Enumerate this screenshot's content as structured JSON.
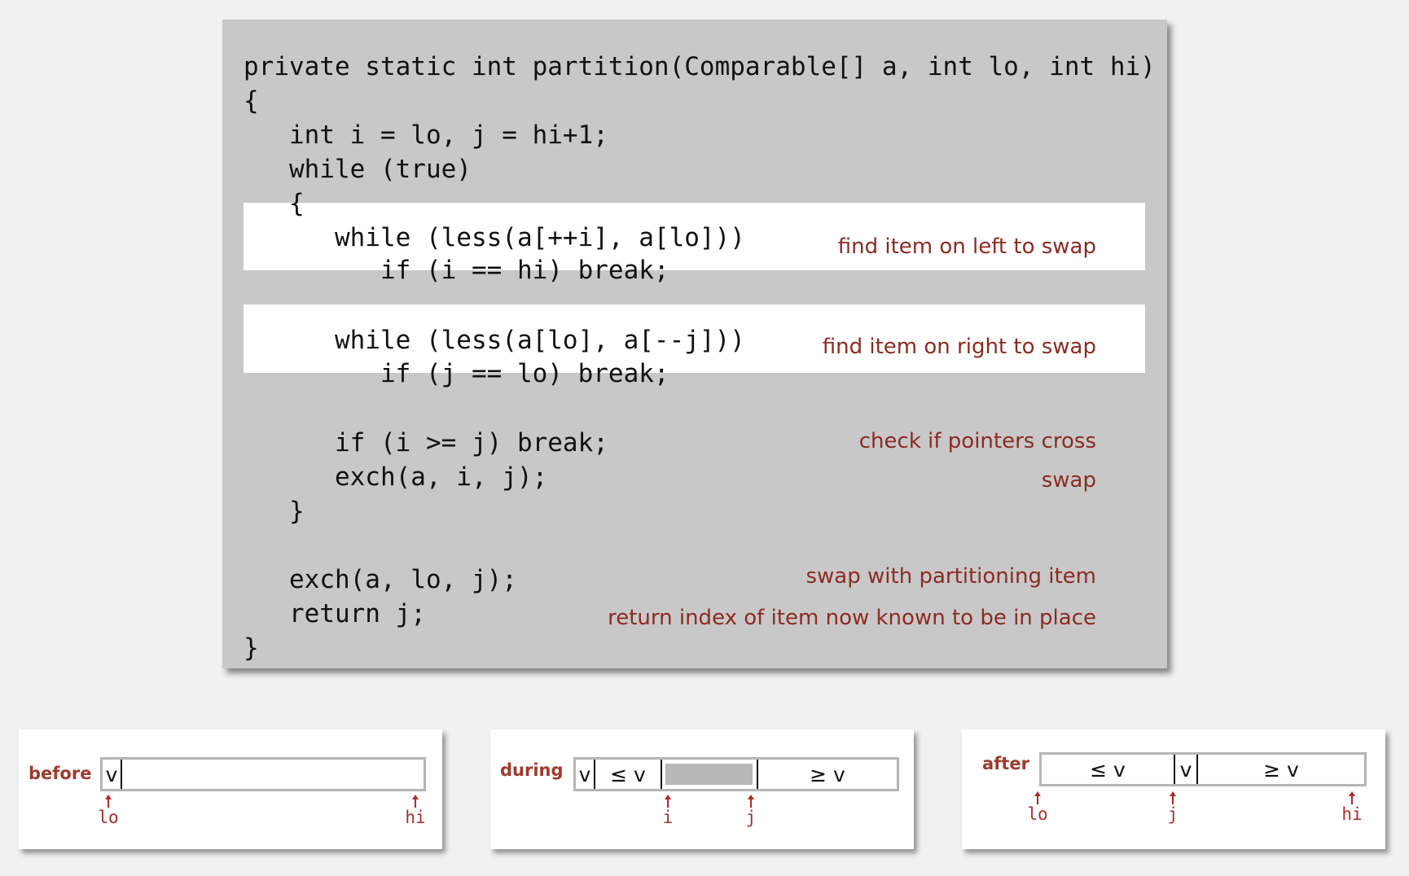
{
  "code_lines": [
    "private static int partition(Comparable[] a, int lo, int hi)",
    "{",
    "   int i = lo, j = hi+1;",
    "   while (true)",
    "   {",
    "      while (less(a[++i], a[lo]))",
    "         if (i == hi) break;",
    "      while (less(a[lo], a[--j]))",
    "         if (j == lo) break;",
    "      if (i >= j) break;",
    "      exch(a, i, j);",
    "   }",
    "   exch(a, lo, j);",
    "   return j;",
    "}"
  ],
  "annotations": [
    "find item on left to swap",
    "find item on right to swap",
    "check if pointers cross",
    "swap",
    "swap with partitioning item",
    "return index of item now known to be in place"
  ],
  "diagrams": {
    "before": {
      "label": "before",
      "cells": [
        "v"
      ],
      "pointers": [
        "lo",
        "hi"
      ]
    },
    "during": {
      "label": "during",
      "cells": [
        "v",
        "≤ v",
        "≥ v"
      ],
      "pointers": [
        "i",
        "j"
      ]
    },
    "after": {
      "label": "after",
      "cells": [
        "≤ v",
        "v",
        "≥ v"
      ],
      "pointers": [
        "lo",
        "j",
        "hi"
      ]
    }
  },
  "colors": {
    "annotation": "#8b2b23",
    "label": "#a03a2c",
    "panel": "#c8c8c8",
    "highlight": "#ffffff"
  }
}
